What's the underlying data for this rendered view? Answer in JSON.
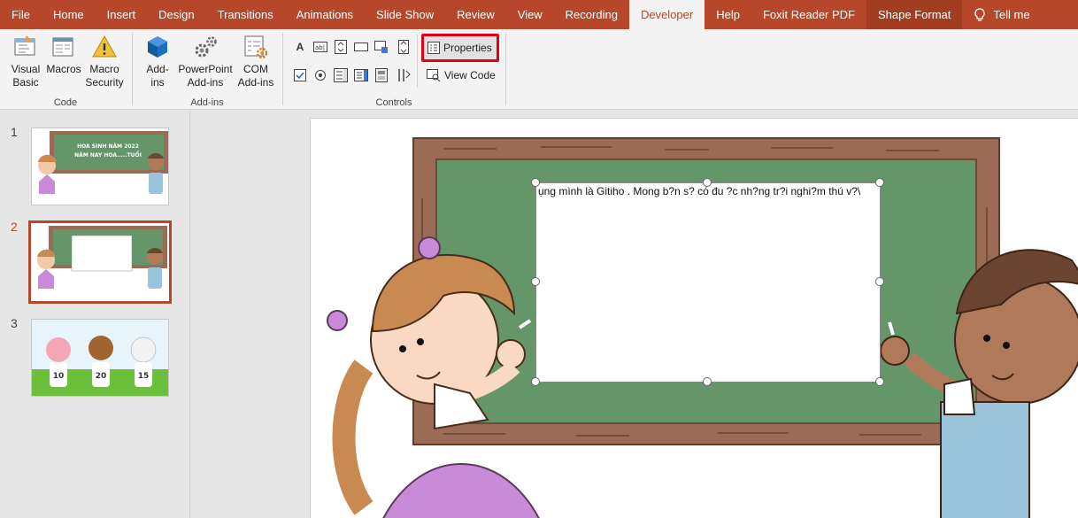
{
  "tabs": [
    "File",
    "Home",
    "Insert",
    "Design",
    "Transitions",
    "Animations",
    "Slide Show",
    "Review",
    "View",
    "Recording",
    "Developer",
    "Help",
    "Foxit Reader PDF",
    "Shape Format"
  ],
  "tell_me": "Tell me",
  "ribbon": {
    "code": {
      "label": "Code",
      "visual_basic": [
        "Visual",
        "Basic"
      ],
      "macros": "Macros",
      "macro_security": [
        "Macro",
        "Security"
      ]
    },
    "addins": {
      "label": "Add-ins",
      "addins": [
        "Add-",
        "ins"
      ],
      "ppt_addins": [
        "PowerPoint",
        "Add-ins"
      ],
      "com_addins": [
        "COM",
        "Add-ins"
      ]
    },
    "controls": {
      "label": "Controls",
      "properties": "Properties",
      "view_code": "View Code"
    }
  },
  "slides": {
    "numbers": [
      "1",
      "2",
      "3"
    ],
    "slide1_title": [
      "HOA SINH NĂM 2022",
      "NĂM NAY HOA.....TUỔI"
    ],
    "slide3_numbers": [
      "10",
      "20",
      "15"
    ]
  },
  "textbox_text": "ụng mình là Gitiho . Mong b?n s? có đu ?c nh?ng tr?i nghi?m thú v?\\",
  "colors": {
    "accent": "#b7472a",
    "board": "#64966a",
    "frame": "#9b6b55",
    "highlight": "#e0001a"
  }
}
